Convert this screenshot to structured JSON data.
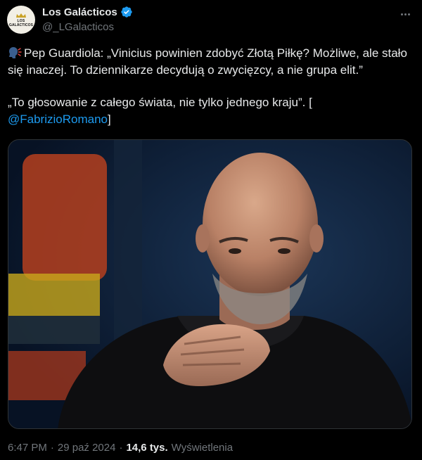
{
  "author": {
    "display_name": "Los Galácticos",
    "handle": "@_LGalacticos",
    "avatar_text_line1": "LOS",
    "avatar_text_line2": "GALÁCTICOS",
    "verified_color": "#1d9bf0"
  },
  "tweet": {
    "emoji_icon": "speaking-head-emoji",
    "line1": "Pep Guardiola: „Vinicius powinien zdobyć Złotą Piłkę? Możliwe, ale stało się inaczej. To dziennikarze decydują o zwycięzcy, a nie grupa elit.”",
    "line2_prefix": "„To głosowanie z całego świata, nie tylko jednego kraju”. [",
    "mention": "@FabrizioRomano",
    "line2_suffix": "]"
  },
  "meta": {
    "time": "6:47 PM",
    "date": "29 paź 2024",
    "views_count": "14,6 tys.",
    "views_label": "Wyświetlenia",
    "separator": "·"
  },
  "colors": {
    "background": "#000000",
    "text": "#e7e9ea",
    "muted": "#71767b",
    "link": "#1d9bf0"
  }
}
